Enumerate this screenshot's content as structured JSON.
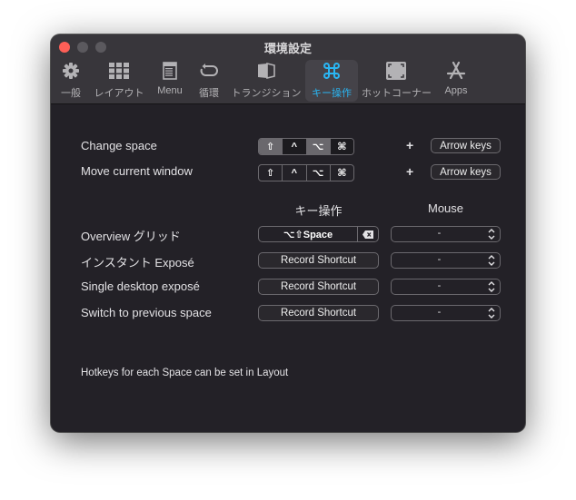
{
  "window": {
    "title": "環境設定"
  },
  "tabs": [
    {
      "label": "一般",
      "icon": "gear-icon"
    },
    {
      "label": "レイアウト",
      "icon": "grid-icon"
    },
    {
      "label": "Menu",
      "icon": "menu-document-icon"
    },
    {
      "label": "循環",
      "icon": "cycle-arrow-icon"
    },
    {
      "label": "トランジション",
      "icon": "transition-cube-icon"
    },
    {
      "label": "キー操作",
      "icon": "command-key-icon",
      "active": true
    },
    {
      "label": "ホットコーナー",
      "icon": "hot-corners-icon"
    },
    {
      "label": "Apps",
      "icon": "app-store-icon"
    }
  ],
  "accent_color": "#2ab6f3",
  "modifier_rows": [
    {
      "label": "Change space",
      "modifiers": [
        {
          "symbol": "⇧",
          "name": "shift",
          "on": true
        },
        {
          "symbol": "^",
          "name": "control",
          "on": false
        },
        {
          "symbol": "⌥",
          "name": "option",
          "on": true
        },
        {
          "symbol": "⌘",
          "name": "command",
          "on": false
        }
      ],
      "plus": "+",
      "key_button": "Arrow keys"
    },
    {
      "label": "Move current window",
      "modifiers": [
        {
          "symbol": "⇧",
          "name": "shift",
          "on": false
        },
        {
          "symbol": "^",
          "name": "control",
          "on": false
        },
        {
          "symbol": "⌥",
          "name": "option",
          "on": false
        },
        {
          "symbol": "⌘",
          "name": "command",
          "on": false
        }
      ],
      "plus": "+",
      "key_button": "Arrow keys"
    }
  ],
  "columns": {
    "keys": "キー操作",
    "mouse": "Mouse"
  },
  "shortcut_rows": [
    {
      "label": "Overview グリッド",
      "shortcut": "⌥⇧Space",
      "recorded": true,
      "mouse": "-"
    },
    {
      "label": "インスタント Exposé",
      "shortcut": "Record Shortcut",
      "recorded": false,
      "mouse": "-"
    },
    {
      "label": "Single desktop exposé",
      "shortcut": "Record Shortcut",
      "recorded": false,
      "mouse": "-"
    },
    {
      "label": "Switch to previous space",
      "shortcut": "Record Shortcut",
      "recorded": false,
      "mouse": "-"
    }
  ],
  "note": "Hotkeys for each Space can be set in Layout"
}
